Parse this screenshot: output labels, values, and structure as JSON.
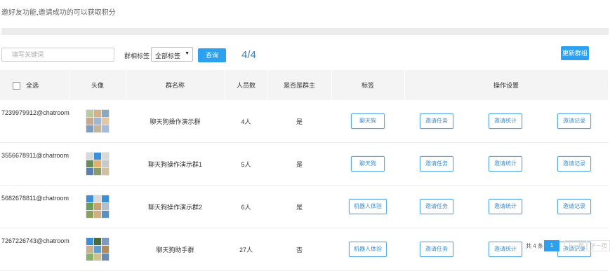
{
  "notice": "邀好友功能,邀请成功的可以获取积分",
  "search": {
    "placeholder": "填写关键词"
  },
  "filter": {
    "label": "群相标签",
    "selected": "全部标签"
  },
  "buttons": {
    "query": "查询",
    "refresh": "更新群组"
  },
  "count": "4/4",
  "table": {
    "headers": {
      "select_all": "全选",
      "avatar": "头像",
      "name": "群名称",
      "members": "人员数",
      "is_owner": "是否是群主",
      "tag": "标签",
      "ops": "操作设置"
    },
    "rows": [
      {
        "id": "7239979912@chatroom",
        "name": "聊天狗操作演示群",
        "members": "4人",
        "is_owner": "是",
        "tag": "聊天狗",
        "ops": [
          "邀请任务",
          "邀请统计",
          "邀请记录"
        ],
        "avatar_colors": [
          "#b9c9a3",
          "#d7b08a",
          "#8aa7c4",
          "#c9a98e",
          "#9fb7d2",
          "#e2c7a4",
          "#7f9fc0",
          "#c4b59a",
          "#a6bcd6"
        ]
      },
      {
        "id": "3556678911@chatroom",
        "name": "聊天狗操作演示群1",
        "members": "5人",
        "is_owner": "是",
        "tag": "聊天狗",
        "ops": [
          "邀请任务",
          "邀请统计",
          "邀请记录"
        ],
        "avatar_colors": [
          "#d9d9d9",
          "#3a8fd6",
          "#d9d9d9",
          "#6a8c5a",
          "#e0b070",
          "#c9c9c9",
          "#5a7fb0",
          "#8a9a6a",
          "#d0c0a0"
        ]
      },
      {
        "id": "5682678811@chatroom",
        "name": "聊天狗操作演示群2",
        "members": "6人",
        "is_owner": "是",
        "tag": "机器人体验",
        "ops": [
          "邀请任务",
          "邀请统计",
          "邀请记录"
        ],
        "avatar_colors": [
          "#3a8fd6",
          "#d9d9d9",
          "#3a8fd6",
          "#6a9c5a",
          "#c9a070",
          "#b0c0d0",
          "#8aa060",
          "#d0b080",
          "#5a8fc0"
        ]
      },
      {
        "id": "7267226743@chatroom",
        "name": "聊天狗助手群",
        "members": "27人",
        "is_owner": "否",
        "tag": "机器人体验",
        "ops": [
          "邀请任务",
          "邀请统计",
          "邀请记录"
        ],
        "avatar_colors": [
          "#3a8fd6",
          "#4a6a3a",
          "#7a9ac0",
          "#c9b090",
          "#5aa0d0",
          "#b08a60",
          "#8ab070",
          "#d0c090",
          "#6a8ab0"
        ]
      }
    ]
  },
  "pagination": {
    "total": "共 4 条",
    "current": "1",
    "prev": "上一页",
    "next": "下一页"
  }
}
